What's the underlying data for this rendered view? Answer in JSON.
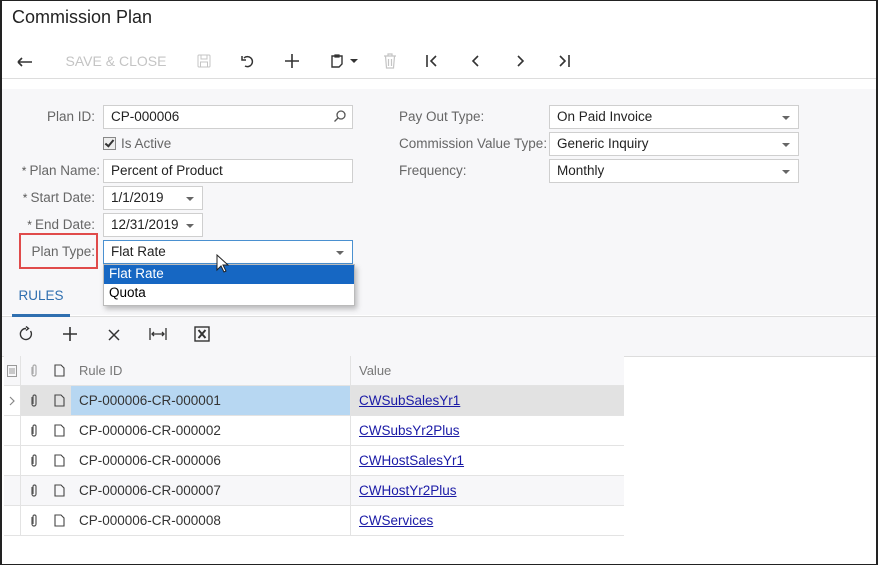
{
  "window": {
    "title": "Commission Plan"
  },
  "toolbar": {
    "back_icon": "arrow-left-icon",
    "save_close_label": "SAVE & CLOSE",
    "save_icon": "save-icon",
    "undo_icon": "undo-icon",
    "add_icon": "plus-icon",
    "copy_icon": "clipboard-icon",
    "delete_icon": "trash-icon",
    "first_icon": "first-record-icon",
    "prev_icon": "previous-icon",
    "next_icon": "next-icon",
    "last_icon": "last-record-icon"
  },
  "form": {
    "plan_id": {
      "label": "Plan ID:",
      "value": "CP-000006"
    },
    "is_active": {
      "label": "Is Active",
      "checked": true
    },
    "plan_name": {
      "label": "Plan Name:",
      "value": "Percent of Product",
      "required": "*"
    },
    "start_date": {
      "label": "Start Date:",
      "value": "1/1/2019",
      "required": "*"
    },
    "end_date": {
      "label": "End Date:",
      "value": "12/31/2019",
      "required": "*"
    },
    "plan_type": {
      "label": "Plan Type:",
      "value": "Flat Rate",
      "options": [
        "Flat Rate",
        "Quota"
      ],
      "highlighted_option": "Flat Rate"
    },
    "pay_out_type": {
      "label": "Pay Out Type:",
      "value": "On Paid Invoice"
    },
    "commission_value_type": {
      "label": "Commission Value Type:",
      "value": "Generic Inquiry"
    },
    "frequency": {
      "label": "Frequency:",
      "value": "Monthly"
    }
  },
  "tabs": [
    {
      "label": "RULES",
      "active": true
    }
  ],
  "grid_toolbar": {
    "refresh_icon": "refresh-icon",
    "add_icon": "plus-icon",
    "delete_icon": "close-icon",
    "fit_icon": "fit-columns-icon",
    "excel_icon": "excel-export-icon"
  },
  "grid": {
    "columns": [
      "Rule ID",
      "Value"
    ],
    "rows": [
      {
        "rule_id": "CP-000006-CR-000001",
        "value": "CWSubSalesYr1",
        "current": true
      },
      {
        "rule_id": "CP-000006-CR-000002",
        "value": "CWSubsYr2Plus"
      },
      {
        "rule_id": "CP-000006-CR-000006",
        "value": "CWHostSalesYr1"
      },
      {
        "rule_id": "CP-000006-CR-000007",
        "value": "CWHostYr2Plus"
      },
      {
        "rule_id": "CP-000006-CR-000008",
        "value": "CWServices"
      }
    ]
  },
  "colors": {
    "accent": "#2f6fb0",
    "selection": "#1667c3",
    "highlight_box": "#e04b4b",
    "link": "#1a1aa6"
  }
}
